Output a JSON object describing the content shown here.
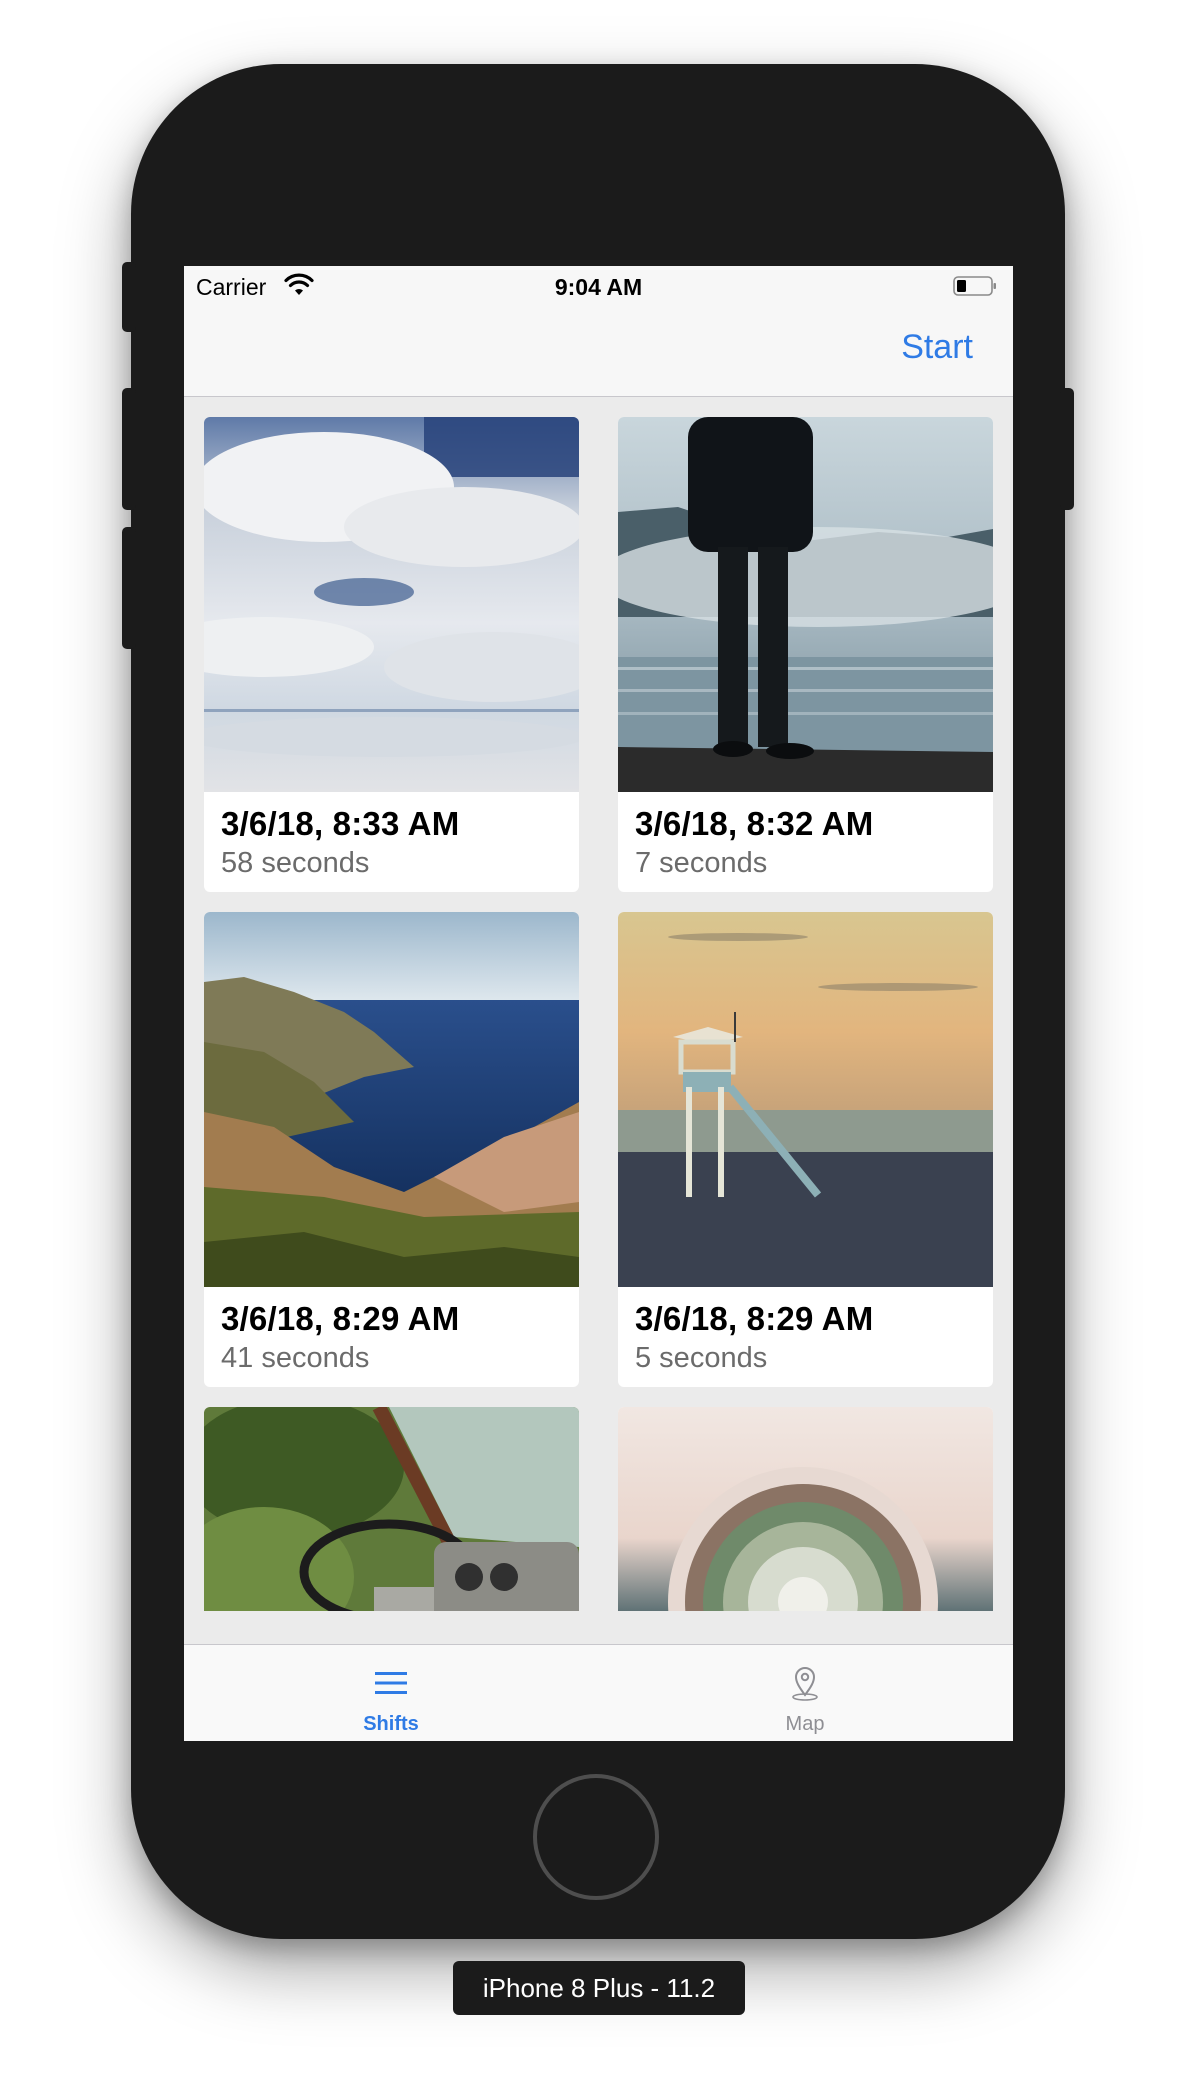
{
  "status_bar": {
    "carrier": "Carrier",
    "time": "9:04 AM"
  },
  "nav": {
    "start_label": "Start"
  },
  "shifts": [
    {
      "date": "3/6/18, 8:33 AM",
      "duration": "58 seconds",
      "image": "clouds-salt-flat-photo"
    },
    {
      "date": "3/6/18, 8:32 AM",
      "duration": "7 seconds",
      "image": "person-misty-lake-photo"
    },
    {
      "date": "3/6/18, 8:29 AM",
      "duration": "41 seconds",
      "image": "coastal-cliffs-sea-photo"
    },
    {
      "date": "3/6/18, 8:29 AM",
      "duration": "5 seconds",
      "image": "lifeguard-tower-beach-photo"
    },
    {
      "image": "abandoned-truck-steering-wheel-photo"
    },
    {
      "image": "cactus-pot-photo"
    }
  ],
  "tabs": [
    {
      "label": "Shifts",
      "icon": "list-icon",
      "selected": true
    },
    {
      "label": "Map",
      "icon": "map-pin-icon",
      "selected": false
    }
  ],
  "colors": {
    "accent": "#2f7be5",
    "inactive_tab": "#8e8e93"
  },
  "device_label": "iPhone 8 Plus - 11.2"
}
